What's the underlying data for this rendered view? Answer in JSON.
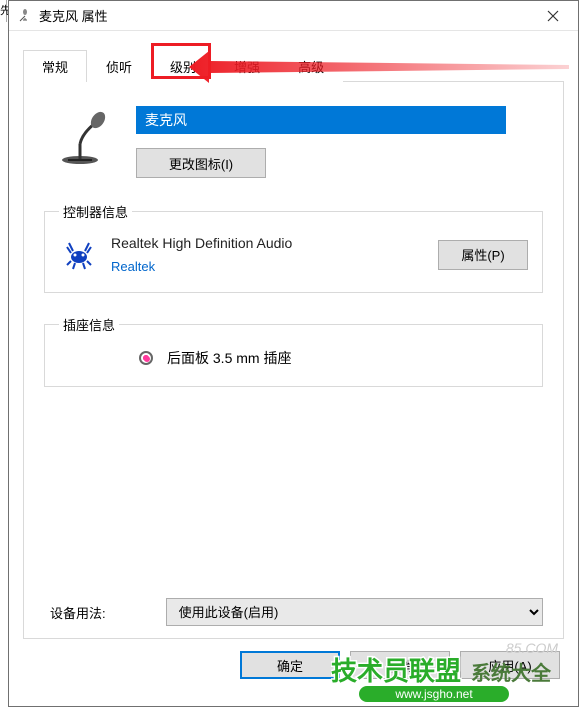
{
  "window": {
    "title": "麦克风 属性"
  },
  "tabs": {
    "general": "常规",
    "listen": "侦听",
    "levels": "级别",
    "enhance": "增强",
    "advanced": "高级"
  },
  "device": {
    "name": "麦克风",
    "change_icon": "更改图标(I)"
  },
  "controller": {
    "legend": "控制器信息",
    "name": "Realtek High Definition Audio",
    "vendor": "Realtek",
    "properties_btn": "属性(P)"
  },
  "jack": {
    "legend": "插座信息",
    "label": "后面板 3.5 mm 插座"
  },
  "usage": {
    "label": "设备用法:",
    "value": "使用此设备(启用)"
  },
  "buttons": {
    "ok": "确定",
    "cancel": "取消",
    "apply": "应用(A)"
  },
  "overlay": {
    "watermark": "85.COM",
    "logo_text": "技术员联盟",
    "logo_sub": "系统大全",
    "url": "www.jsgho.net"
  },
  "truncated": "先"
}
